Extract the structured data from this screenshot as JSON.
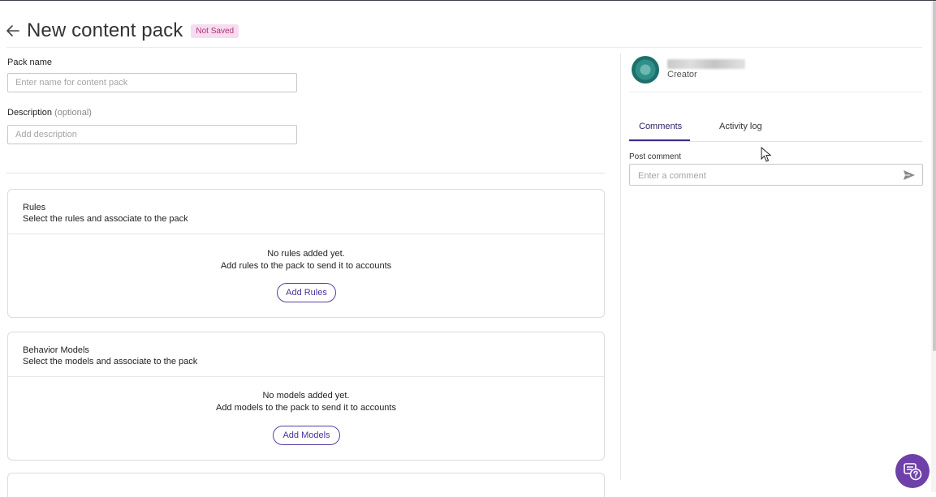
{
  "header": {
    "title": "New content pack",
    "status_badge": "Not Saved"
  },
  "form": {
    "pack_name_label": "Pack name",
    "pack_name_placeholder": "Enter name for content pack",
    "pack_name_value": "",
    "description_label": "Description",
    "description_optional": "(optional)",
    "description_placeholder": "Add description",
    "description_value": ""
  },
  "rules_card": {
    "title": "Rules",
    "subtitle": "Select the rules and associate to the pack",
    "empty_title": "No rules added yet.",
    "empty_desc": "Add rules to the pack to send it to accounts",
    "button_label": "Add Rules"
  },
  "models_card": {
    "title": "Behavior Models",
    "subtitle": "Select the models and associate to the pack",
    "empty_title": "No models added yet.",
    "empty_desc": "Add models to the pack to send it to accounts",
    "button_label": "Add Models"
  },
  "sidebar": {
    "user_role": "Creator",
    "tabs": [
      {
        "label": "Comments",
        "active": true
      },
      {
        "label": "Activity log",
        "active": false
      }
    ],
    "post_comment_label": "Post comment",
    "comment_placeholder": "Enter a comment"
  },
  "icons": {
    "back": "arrow-left-icon",
    "send": "send-icon",
    "help": "help-chat-icon"
  },
  "colors": {
    "accent": "#4b3399",
    "badge_bg": "#f6dcef",
    "badge_text": "#b0307a",
    "help_fab": "#6e40aa"
  }
}
